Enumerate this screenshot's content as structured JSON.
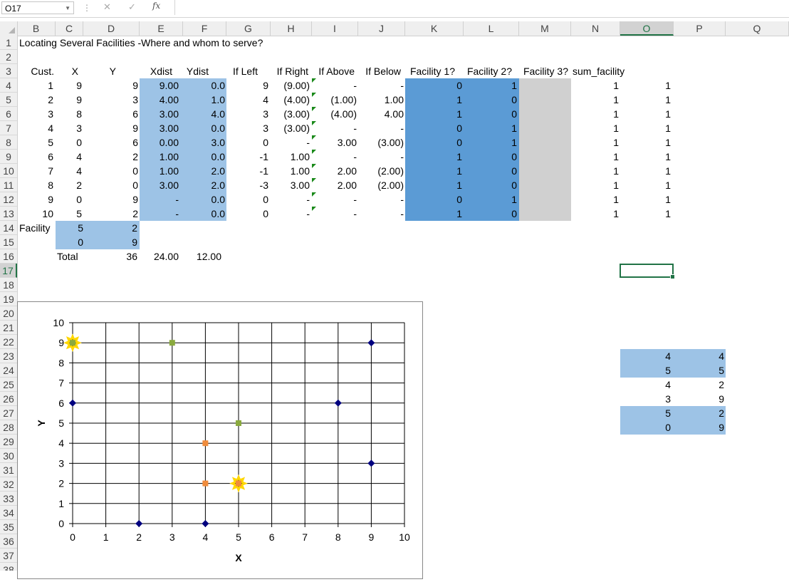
{
  "formula_bar": {
    "name_box": "O17",
    "fx_label": "fx",
    "cancel_glyph": "✕",
    "enter_glyph": "✓",
    "formula": ""
  },
  "columns": [
    "B",
    "C",
    "D",
    "E",
    "F",
    "G",
    "H",
    "I",
    "J",
    "K",
    "L",
    "M",
    "N",
    "O",
    "P",
    "Q"
  ],
  "selected_column": "O",
  "rows": [
    "1",
    "2",
    "3",
    "4",
    "5",
    "6",
    "7",
    "8",
    "9",
    "10",
    "11",
    "12",
    "13",
    "14",
    "15",
    "16",
    "17",
    "18",
    "19",
    "20",
    "21",
    "22",
    "23",
    "24",
    "25",
    "26",
    "27",
    "28",
    "29",
    "30",
    "31",
    "32",
    "33",
    "34",
    "35",
    "36",
    "37",
    "38"
  ],
  "selected_row": "17",
  "sheet": {
    "title": "Locating Several Facilities -Where and whom to serve?",
    "headers": [
      "Cust.",
      "X",
      "Y",
      "Xdist",
      "Ydist",
      "If Left",
      "If Right",
      "If Above",
      "If Below",
      "Facility 1?",
      "Facility 2?",
      "Facility 3?",
      "sum_facility"
    ],
    "table": [
      [
        "1",
        "9",
        "9",
        "9.00",
        "0.0",
        "9",
        "(9.00)",
        "-",
        "-",
        "0",
        "1",
        "",
        "1",
        "1"
      ],
      [
        "2",
        "9",
        "3",
        "4.00",
        "1.0",
        "4",
        "(4.00)",
        "(1.00)",
        "1.00",
        "1",
        "0",
        "",
        "1",
        "1"
      ],
      [
        "3",
        "8",
        "6",
        "3.00",
        "4.0",
        "3",
        "(3.00)",
        "(4.00)",
        "4.00",
        "1",
        "0",
        "",
        "1",
        "1"
      ],
      [
        "4",
        "3",
        "9",
        "3.00",
        "0.0",
        "3",
        "(3.00)",
        "-",
        "-",
        "0",
        "1",
        "",
        "1",
        "1"
      ],
      [
        "5",
        "0",
        "6",
        "0.00",
        "3.0",
        "0",
        "-",
        "3.00",
        "(3.00)",
        "0",
        "1",
        "",
        "1",
        "1"
      ],
      [
        "6",
        "4",
        "2",
        "1.00",
        "0.0",
        "-1",
        "1.00",
        "-",
        "-",
        "1",
        "0",
        "",
        "1",
        "1"
      ],
      [
        "7",
        "4",
        "0",
        "1.00",
        "2.0",
        "-1",
        "1.00",
        "2.00",
        "(2.00)",
        "1",
        "0",
        "",
        "1",
        "1"
      ],
      [
        "8",
        "2",
        "0",
        "3.00",
        "2.0",
        "-3",
        "3.00",
        "2.00",
        "(2.00)",
        "1",
        "0",
        "",
        "1",
        "1"
      ],
      [
        "9",
        "0",
        "9",
        "-",
        "0.0",
        "0",
        "-",
        "-",
        "-",
        "0",
        "1",
        "",
        "1",
        "1"
      ],
      [
        "10",
        "5",
        "2",
        "-",
        "0.0",
        "0",
        "-",
        "-",
        "-",
        "1",
        "0",
        "",
        "1",
        "1"
      ]
    ],
    "facility_label": "Facility",
    "facility_rows": [
      [
        "5",
        "2"
      ],
      [
        "0",
        "9"
      ]
    ],
    "total_label": "Total",
    "totals": [
      "36",
      "24.00",
      "12.00"
    ],
    "side_table": [
      [
        "4",
        "4"
      ],
      [
        "5",
        "5"
      ],
      [
        "4",
        "2"
      ],
      [
        "3",
        "9"
      ],
      [
        "5",
        "2"
      ],
      [
        "0",
        "9"
      ]
    ]
  },
  "colors": {
    "light_blue": "#9dc3e6",
    "mid_blue": "#5b9bd5",
    "gray": "#d0d0d0",
    "excel_green": "#217346"
  },
  "chart_data": {
    "type": "scatter",
    "title": "",
    "xlabel": "X",
    "ylabel": "Y",
    "xlim": [
      0,
      10
    ],
    "ylim": [
      0,
      10
    ],
    "x_ticks": [
      "0",
      "1",
      "2",
      "3",
      "4",
      "5",
      "6",
      "7",
      "8",
      "9",
      "10"
    ],
    "y_ticks": [
      "0",
      "1",
      "2",
      "3",
      "4",
      "5",
      "6",
      "7",
      "8",
      "9",
      "10"
    ],
    "grid": true,
    "legend": "none",
    "series": [
      {
        "color": "#00007f",
        "marker": "diamond",
        "points": [
          [
            9,
            9
          ],
          [
            9,
            3
          ],
          [
            8,
            6
          ],
          [
            0,
            6
          ],
          [
            2,
            0
          ],
          [
            4,
            0
          ]
        ]
      },
      {
        "color": "#f08c3c",
        "marker": "square",
        "points": [
          [
            4,
            4
          ],
          [
            4,
            2
          ],
          [
            5,
            2
          ]
        ]
      },
      {
        "color": "#8aaa3e",
        "marker": "square",
        "points": [
          [
            3,
            9
          ],
          [
            5,
            5
          ],
          [
            0,
            9
          ]
        ]
      },
      {
        "color": "#ffd700",
        "marker": "star",
        "points": [
          [
            5,
            2
          ],
          [
            0,
            9
          ]
        ]
      }
    ]
  }
}
